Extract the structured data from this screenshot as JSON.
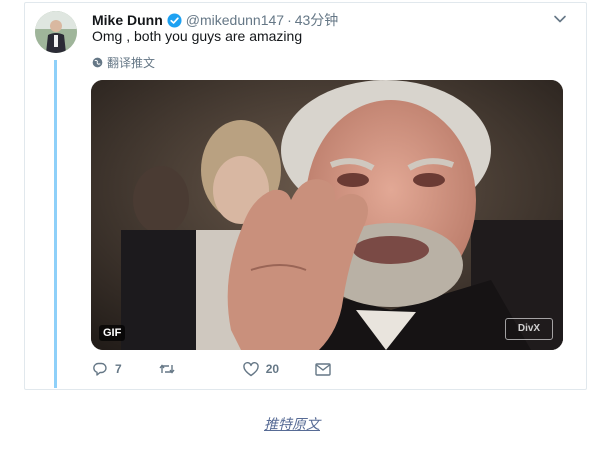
{
  "tweet": {
    "display_name": "Mike Dunn",
    "handle": "@mikedunn147",
    "separator": "·",
    "time": "43分钟",
    "text": "Omg , both you guys are amazing",
    "translate_label": "翻译推文",
    "media": {
      "gif_badge": "GIF",
      "watermark": "DivX"
    },
    "actions": {
      "reply_count": "7",
      "retweet_count": "",
      "like_count": "20"
    }
  },
  "footer": {
    "source_link": "推特原文"
  },
  "colors": {
    "accent_blue": "#1da1f2",
    "thread_line": "#8ed0f9",
    "muted": "#657786",
    "link": "#576b95"
  }
}
